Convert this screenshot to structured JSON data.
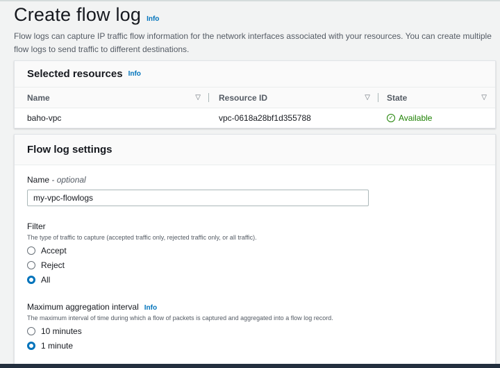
{
  "header": {
    "title": "Create flow log",
    "info_label": "Info",
    "description": "Flow logs can capture IP traffic flow information for the network interfaces associated with your resources. You can create multiple flow logs to send traffic to different destinations."
  },
  "selected_resources": {
    "title": "Selected resources",
    "info_label": "Info",
    "columns": [
      "Name",
      "Resource ID",
      "State"
    ],
    "rows": [
      {
        "name": "baho-vpc",
        "resource_id": "vpc-0618a28bf1d355788",
        "state": "Available"
      }
    ]
  },
  "flow_log_settings": {
    "title": "Flow log settings",
    "name_field": {
      "label": "Name",
      "label_suffix": "- optional",
      "value": "my-vpc-flowlogs"
    },
    "filter": {
      "label": "Filter",
      "description": "The type of traffic to capture (accepted traffic only, rejected traffic only, or all traffic).",
      "options": [
        "Accept",
        "Reject",
        "All"
      ],
      "selected": "All"
    },
    "aggregation": {
      "label": "Maximum aggregation interval",
      "info_label": "Info",
      "description": "The maximum interval of time during which a flow of packets is captured and aggregated into a flow log record.",
      "options": [
        "10 minutes",
        "1 minute"
      ],
      "selected": "1 minute"
    }
  },
  "colors": {
    "link": "#0073bb",
    "success": "#1d8102",
    "radio_selected": "#0073bb"
  },
  "icons": {
    "sort": "sort-caret-down-icon",
    "status": "check-circle-icon"
  }
}
